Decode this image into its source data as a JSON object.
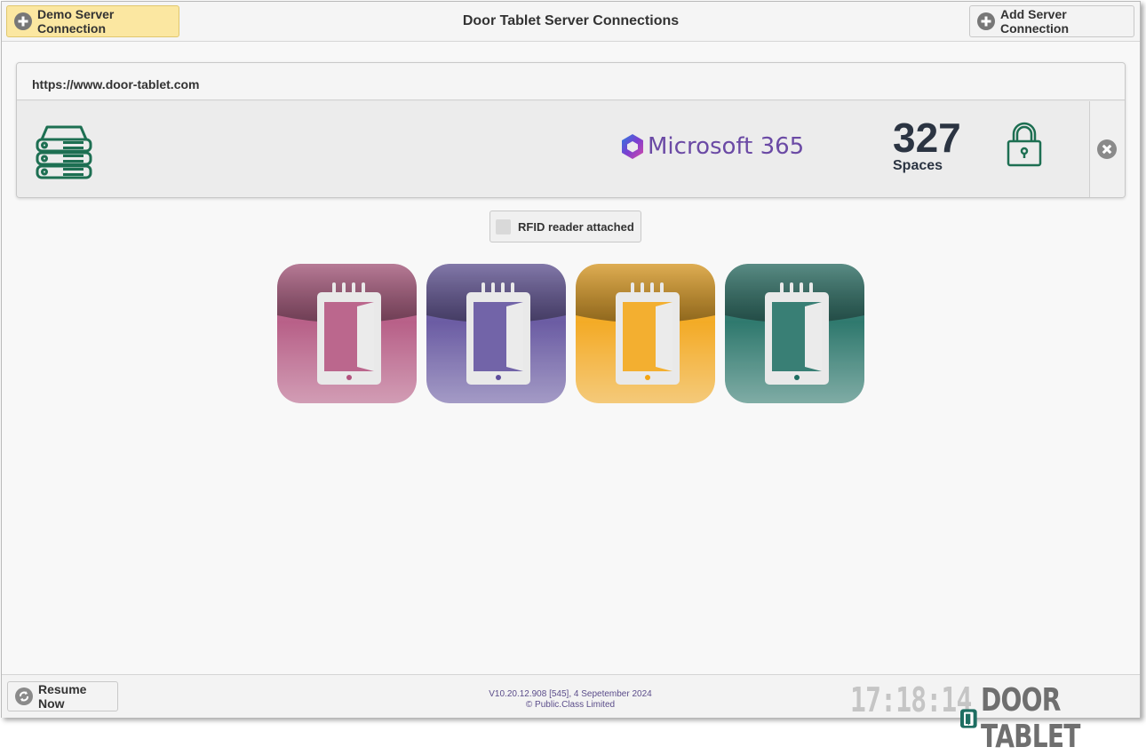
{
  "header": {
    "title": "Door Tablet Server Connections",
    "demo_button_label": "Demo Server Connection",
    "add_button_label": "Add Server Connection"
  },
  "connection": {
    "url": "https://www.door-tablet.com",
    "provider": "Microsoft 365",
    "spaces_count": "327",
    "spaces_label": "Spaces",
    "icons": [
      "server-stack-icon",
      "microsoft-365-logo",
      "lock-icon",
      "close-icon"
    ]
  },
  "rfid": {
    "label": "RFID reader attached",
    "checked": false
  },
  "apps": [
    {
      "name": "door-tablet-app-pink",
      "color": "#b2537e"
    },
    {
      "name": "door-tablet-app-purple",
      "color": "#5f4f9c"
    },
    {
      "name": "door-tablet-app-orange",
      "color": "#f2a414"
    },
    {
      "name": "door-tablet-app-teal",
      "color": "#1e6e62"
    }
  ],
  "footer": {
    "resume_label": "Resume Now",
    "version": "V10.20.12.908 [545], 4 Sepetember 2024",
    "copyright": "© Public.Class Limited",
    "clock": "17:18:14",
    "brand": "DOOR TABLET"
  },
  "colors": {
    "accent_green": "#1d6f52",
    "demo_button_bg": "#fbe7a1",
    "provider_text": "#6b4aa5"
  }
}
